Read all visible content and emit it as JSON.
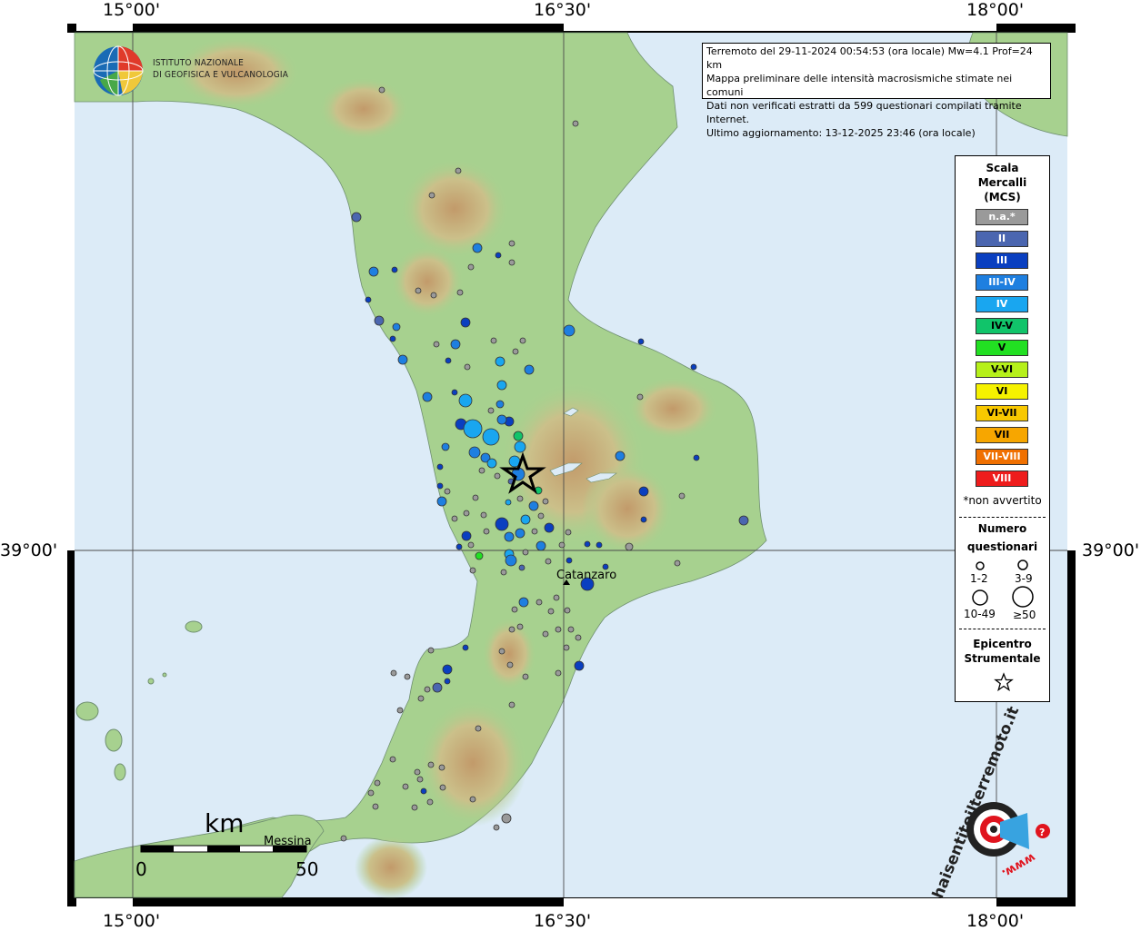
{
  "axes": {
    "top_ticks": [
      "15°00'",
      "16°30'",
      "18°00'"
    ],
    "bottom_ticks": [
      "15°00'",
      "16°30'",
      "18°00'"
    ],
    "left_tick": "39°00'",
    "right_tick": "39°00'"
  },
  "logo": {
    "line1": "ISTITUTO NAZIONALE",
    "line2": "DI GEOFISICA E VULCANOLOGIA"
  },
  "info": {
    "line1": "Terremoto del 29-11-2024 00:54:53 (ora locale) Mw=4.1 Prof=24 km",
    "line2": "Mappa preliminare delle intensità macrosismiche stimate nei comuni",
    "line3": "Dati non verificati estratti da 599 questionari compilati tramite Internet.",
    "line4": "Ultimo aggiornamento: 13-12-2025 23:46 (ora locale)"
  },
  "legend": {
    "title1": "Scala",
    "title2": "Mercalli",
    "title3": "(MCS)",
    "levels": [
      {
        "label": "n.a.*",
        "color": "#9a9a9a"
      },
      {
        "label": "II",
        "color": "#4b66b0"
      },
      {
        "label": "III",
        "color": "#0a3fc0"
      },
      {
        "label": "III-IV",
        "color": "#1e7fe0"
      },
      {
        "label": "IV",
        "color": "#19a6f0"
      },
      {
        "label": "IV-V",
        "color": "#11c46a"
      },
      {
        "label": "V",
        "color": "#22e022"
      },
      {
        "label": "V-VI",
        "color": "#b6f01a"
      },
      {
        "label": "VI",
        "color": "#f6f200"
      },
      {
        "label": "VI-VII",
        "color": "#f8c800"
      },
      {
        "label": "VII",
        "color": "#f7a600"
      },
      {
        "label": "VII-VIII",
        "color": "#f07000"
      },
      {
        "label": "VIII",
        "color": "#ee1c1c"
      }
    ],
    "not_felt_note": "*non avvertito",
    "count_title1": "Numero",
    "count_title2": "questionari",
    "count_labels": [
      "1-2",
      "3-9",
      "10-49",
      "≥50"
    ],
    "epicenter_title1": "Epicentro",
    "epicenter_title2": "Strumentale"
  },
  "places": {
    "catanzaro": "Catanzaro",
    "messina": "Messina"
  },
  "scalebar": {
    "unit": "km",
    "start": "0",
    "end": "50"
  },
  "brand": {
    "site_text": "haisentitoilterremoto.it",
    "www_text": "www."
  },
  "colors": {
    "sea": "#dcebf7",
    "land_low": "#9ccf8a",
    "land_mid": "#c9c48a",
    "land_high": "#c79f6f",
    "frame": "#000000"
  }
}
